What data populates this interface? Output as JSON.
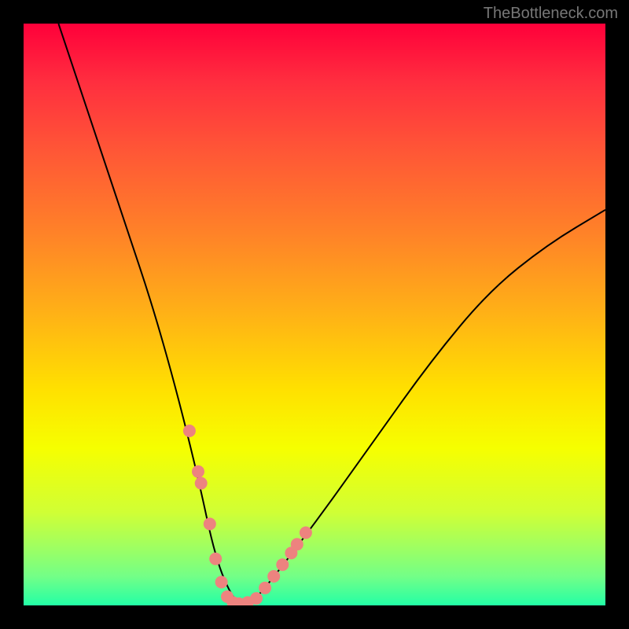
{
  "watermark": "TheBottleneck.com",
  "chart_data": {
    "type": "line",
    "title": "",
    "xlabel": "",
    "ylabel": "",
    "xlim": [
      0,
      100
    ],
    "ylim": [
      0,
      100
    ],
    "series": [
      {
        "name": "bottleneck-curve",
        "x": [
          6,
          10,
          14,
          18,
          22,
          26,
          30,
          33,
          36,
          38,
          40,
          50,
          60,
          70,
          80,
          90,
          100
        ],
        "y": [
          100,
          88,
          76,
          64,
          52,
          38,
          22,
          8,
          1,
          0,
          1,
          14,
          28,
          42,
          54,
          62,
          68
        ]
      }
    ],
    "markers": {
      "name": "highlighted-points",
      "color": "#ed837f",
      "x": [
        28.5,
        30.0,
        30.5,
        32.0,
        33.0,
        34.0,
        35.0,
        36.0,
        37.0,
        38.5,
        40.0,
        41.5,
        43.0,
        44.5,
        46.0,
        47.0,
        48.5
      ],
      "y": [
        30.0,
        23.0,
        21.0,
        14.0,
        8.0,
        4.0,
        1.5,
        0.5,
        0.3,
        0.5,
        1.2,
        3.0,
        5.0,
        7.0,
        9.0,
        10.5,
        12.5
      ]
    },
    "background_gradient_stops": [
      {
        "pos": 0,
        "color": "#ff003a"
      },
      {
        "pos": 10,
        "color": "#ff2e3f"
      },
      {
        "pos": 22,
        "color": "#ff5736"
      },
      {
        "pos": 36,
        "color": "#ff8228"
      },
      {
        "pos": 50,
        "color": "#ffb216"
      },
      {
        "pos": 63,
        "color": "#ffe100"
      },
      {
        "pos": 73,
        "color": "#f6ff00"
      },
      {
        "pos": 84,
        "color": "#d0ff35"
      },
      {
        "pos": 90,
        "color": "#9fff61"
      },
      {
        "pos": 95,
        "color": "#73ff87"
      },
      {
        "pos": 100,
        "color": "#23ffa6"
      }
    ]
  }
}
